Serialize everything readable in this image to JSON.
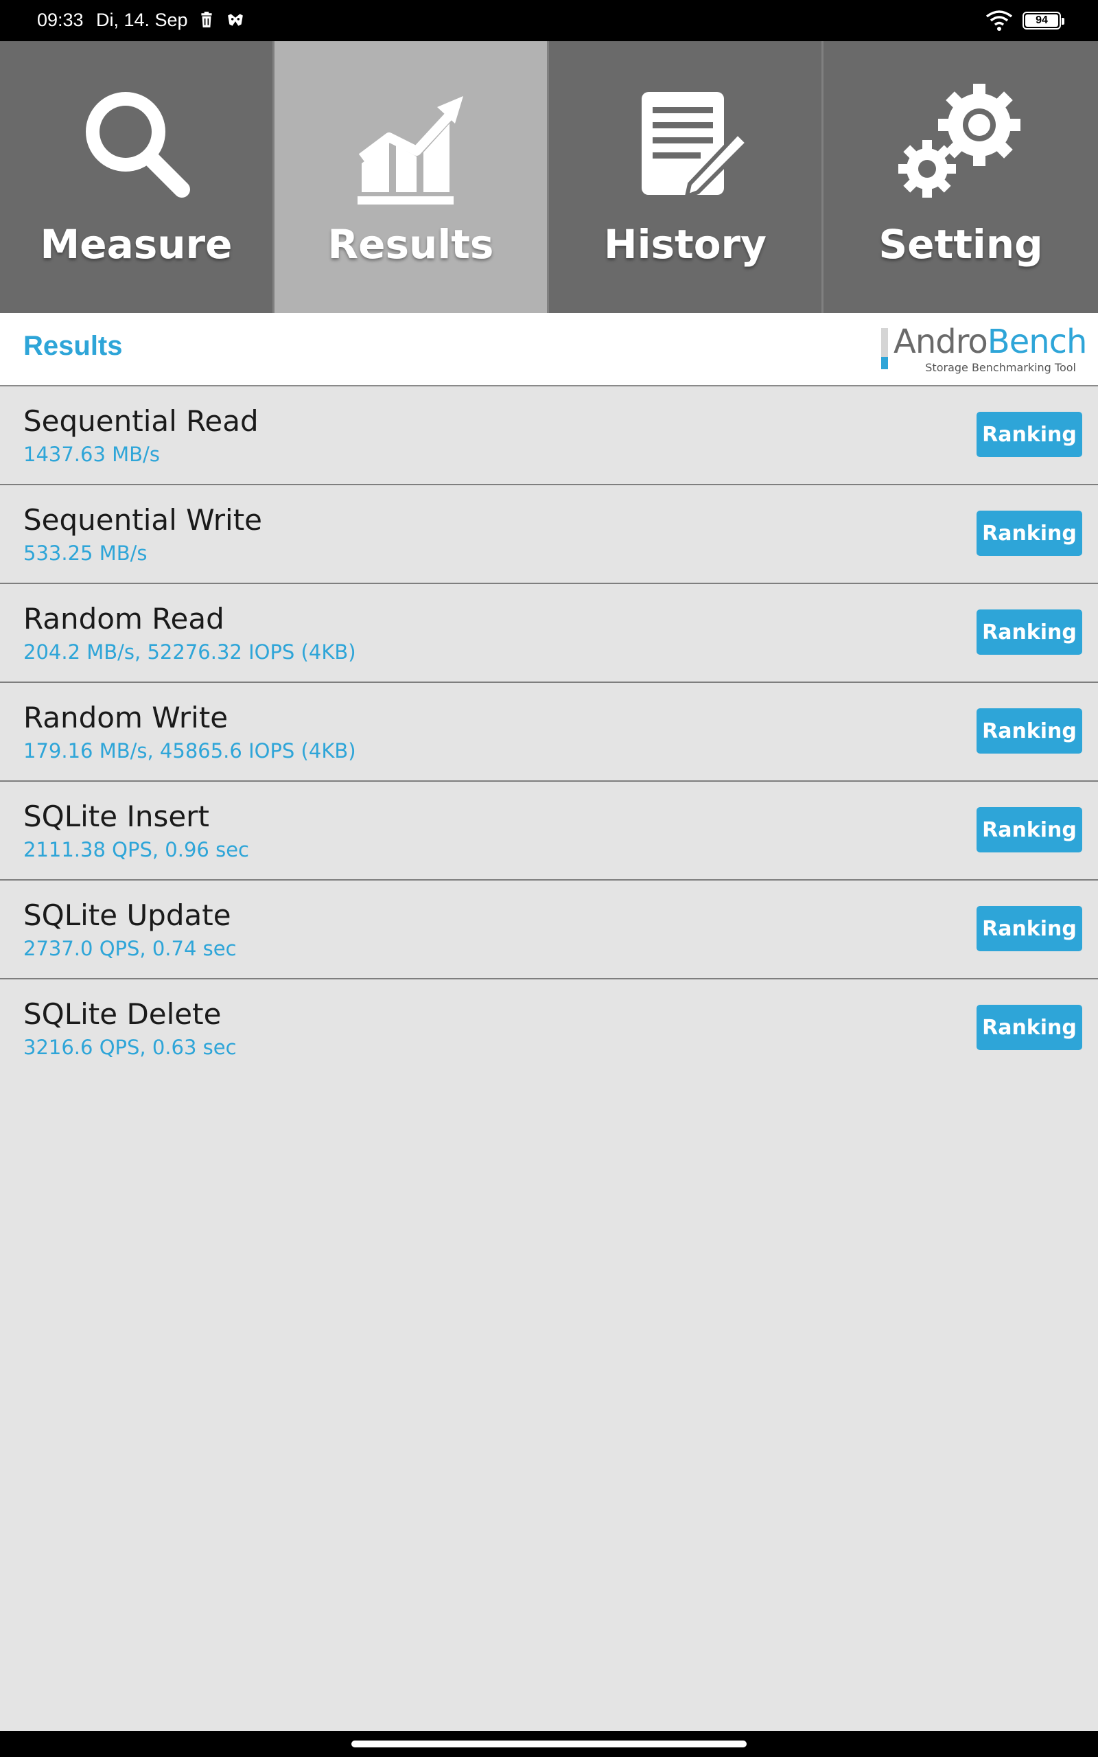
{
  "status_bar": {
    "time": "09:33",
    "date": "Di, 14. Sep",
    "battery_level": "94",
    "icons": [
      "trash-icon",
      "mask-icon",
      "wifi-icon",
      "battery-icon"
    ]
  },
  "tabs": [
    {
      "label": "Measure",
      "icon": "magnifier-icon",
      "active": false
    },
    {
      "label": "Results",
      "icon": "chart-icon",
      "active": true
    },
    {
      "label": "History",
      "icon": "document-pen-icon",
      "active": false
    },
    {
      "label": "Setting",
      "icon": "gears-icon",
      "active": false
    }
  ],
  "header": {
    "title": "Results",
    "logo_andro": "Andro",
    "logo_bench": "Bench",
    "logo_subtitle": "Storage Benchmarking Tool"
  },
  "results": [
    {
      "title": "Sequential Read",
      "value": "1437.63 MB/s",
      "button": "Ranking"
    },
    {
      "title": "Sequential Write",
      "value": "533.25 MB/s",
      "button": "Ranking"
    },
    {
      "title": "Random Read",
      "value": "204.2 MB/s, 52276.32 IOPS (4KB)",
      "button": "Ranking"
    },
    {
      "title": "Random Write",
      "value": "179.16 MB/s, 45865.6 IOPS (4KB)",
      "button": "Ranking"
    },
    {
      "title": "SQLite Insert",
      "value": "2111.38 QPS, 0.96 sec",
      "button": "Ranking"
    },
    {
      "title": "SQLite Update",
      "value": "2737.0 QPS, 0.74 sec",
      "button": "Ranking"
    },
    {
      "title": "SQLite Delete",
      "value": "3216.6 QPS, 0.63 sec",
      "button": "Ranking"
    }
  ],
  "colors": {
    "accent": "#2ea5d8",
    "tab_bg": "#6a6a6a",
    "tab_active_bg": "#b2b2b2",
    "content_bg": "#e4e4e4"
  }
}
